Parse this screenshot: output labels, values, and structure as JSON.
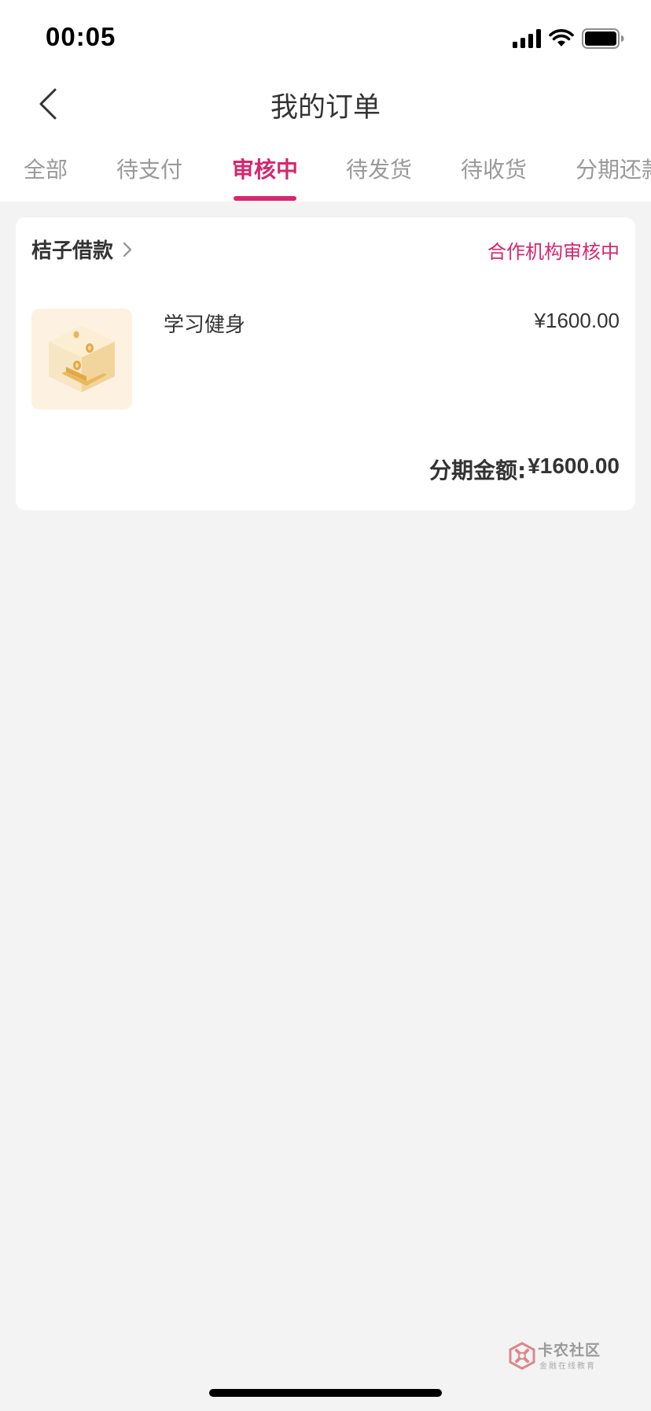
{
  "status_bar": {
    "time": "00:05",
    "icons": [
      "cellular-signal-icon",
      "wifi-icon",
      "battery-icon"
    ]
  },
  "navbar": {
    "title": "我的订单",
    "back_icon": "chevron-left-icon"
  },
  "tabs": [
    {
      "label": "全部",
      "active": false
    },
    {
      "label": "待支付",
      "active": false
    },
    {
      "label": "审核中",
      "active": true
    },
    {
      "label": "待发货",
      "active": false
    },
    {
      "label": "待收货",
      "active": false
    },
    {
      "label": "分期还款",
      "active": false
    }
  ],
  "order": {
    "merchant": "桔子借款",
    "merchant_icon": "chevron-right-icon",
    "status": "合作机构审核中",
    "product": {
      "name": "学习健身",
      "price": "¥1600.00",
      "thumb_icon": "coin-box-illustration"
    },
    "installment_label": "分期金额:",
    "installment_amount": "¥1600.00"
  },
  "watermark": {
    "title": "卡农社区",
    "subtitle": "金融在线教育"
  },
  "colors": {
    "accent": "#d6266e",
    "background": "#f3f3f3",
    "tab_inactive": "#999999"
  }
}
